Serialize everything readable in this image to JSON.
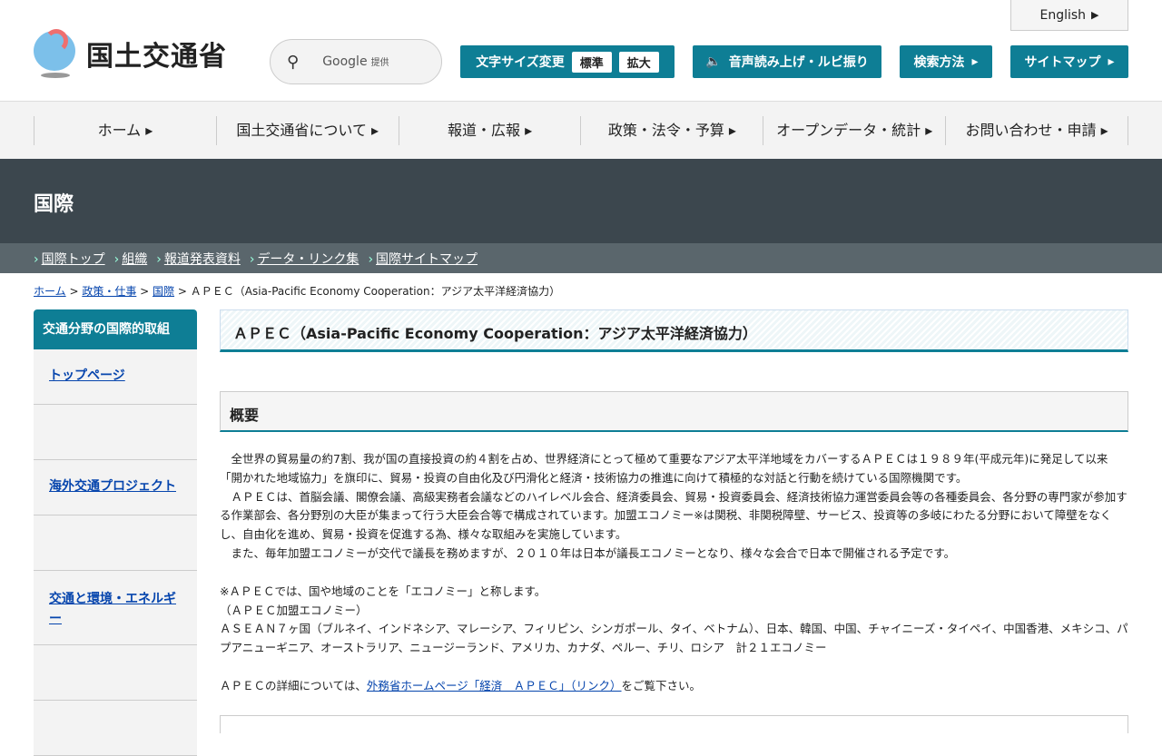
{
  "header": {
    "logo_text": "国土交通省",
    "search_brand": "Google",
    "search_provided": "提供",
    "font_size_label": "文字サイズ変更",
    "font_standard": "標準",
    "font_large": "拡大",
    "speech_label": "音声読み上げ・ルビ振り",
    "search_method": "検索方法",
    "sitemap": "サイトマップ",
    "english": "English"
  },
  "gnav": [
    "ホーム ▸",
    "国土交通省について ▸",
    "報道・広報 ▸",
    "政策・法令・予算 ▸",
    "オープンデータ・統計 ▸",
    "お問い合わせ・申請 ▸"
  ],
  "section_title": "国際",
  "subnav": [
    "国際トップ",
    "組織",
    "報道発表資料",
    "データ・リンク集",
    "国際サイトマップ"
  ],
  "breadcrumb": {
    "items": [
      "ホーム",
      "政策・仕事",
      "国際"
    ],
    "current": "ＡＰＥＣ（Asia-Pacific Economy Cooperation：アジア太平洋経済協力）"
  },
  "sidebar": {
    "title": "交通分野の国際的取組",
    "items": [
      "トップページ",
      "",
      "海外交通プロジェクト",
      "",
      "交通と環境・エネルギー",
      "",
      ""
    ]
  },
  "main": {
    "title": "ＡＰＥＣ（Asia-Pacific Economy Cooperation：アジア太平洋経済協力）",
    "overview": "概要",
    "paragraphs": [
      "　全世界の貿易量の約7割、我が国の直接投資の約４割を占め、世界経済にとって極めて重要なアジア太平洋地域をカバーするＡＰＥＣは１９８９年(平成元年)に発足して以来「開かれた地域協力」を旗印に、貿易・投資の自由化及び円滑化と経済・技術協力の推進に向けて積極的な対話と行動を続けている国際機関です。",
      "　ＡＰＥＣは、首脳会議、閣僚会議、高級実務者会議などのハイレベル会合、経済委員会、貿易・投資委員会、経済技術協力運営委員会等の各種委員会、各分野の専門家が参加する作業部会、各分野別の大臣が集まって行う大臣会合等で構成されています。加盟エコノミー※は関税、非関税障壁、サービス、投資等の多岐にわたる分野において障壁をなくし、自由化を進め、貿易・投資を促進する為、様々な取組みを実施しています。",
      "　また、毎年加盟エコノミーが交代で議長を務めますが、２０１０年は日本が議長エコノミーとなり、様々な会合で日本で開催される予定です。"
    ],
    "note": [
      "※ＡＰＥＣでは、国や地域のことを「エコノミー」と称します。",
      "（ＡＰＥＣ加盟エコノミー）",
      "ＡＳＥＡＮ７ヶ国（ブルネイ、インドネシア、マレーシア、フィリピン、シンガポール、タイ、ベトナム）、日本、韓国、中国、チャイニーズ・タイペイ、中国香港、メキシコ、パプアニューギニア、オーストラリア、ニュージーランド、アメリカ、カナダ、ペルー、チリ、ロシア　計２１エコノミー"
    ],
    "detail_pre": "ＡＰＥＣの詳細については、",
    "detail_link": "外務省ホームページ「経済　ＡＰＥＣ」（リンク）",
    "detail_post": "をご覧下さい。"
  }
}
